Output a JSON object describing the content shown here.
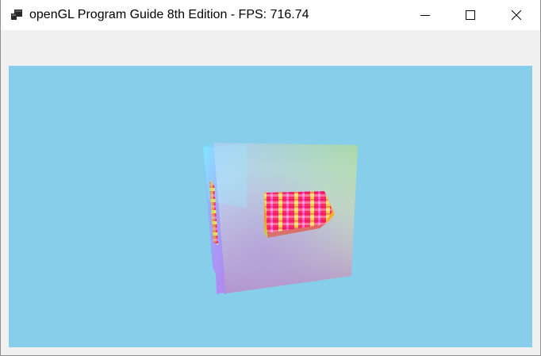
{
  "window": {
    "title": "openGL Program Guide 8th Edition - FPS: 716.74",
    "icon": "app-window-icon",
    "controls": {
      "minimize_icon": "minimize-icon",
      "maximize_icon": "maximize-icon",
      "close_icon": "close-icon"
    }
  },
  "viewport": {
    "background_color": "#87ceeb",
    "scene": "rgb-cube-with-striped-texture-insets"
  }
}
